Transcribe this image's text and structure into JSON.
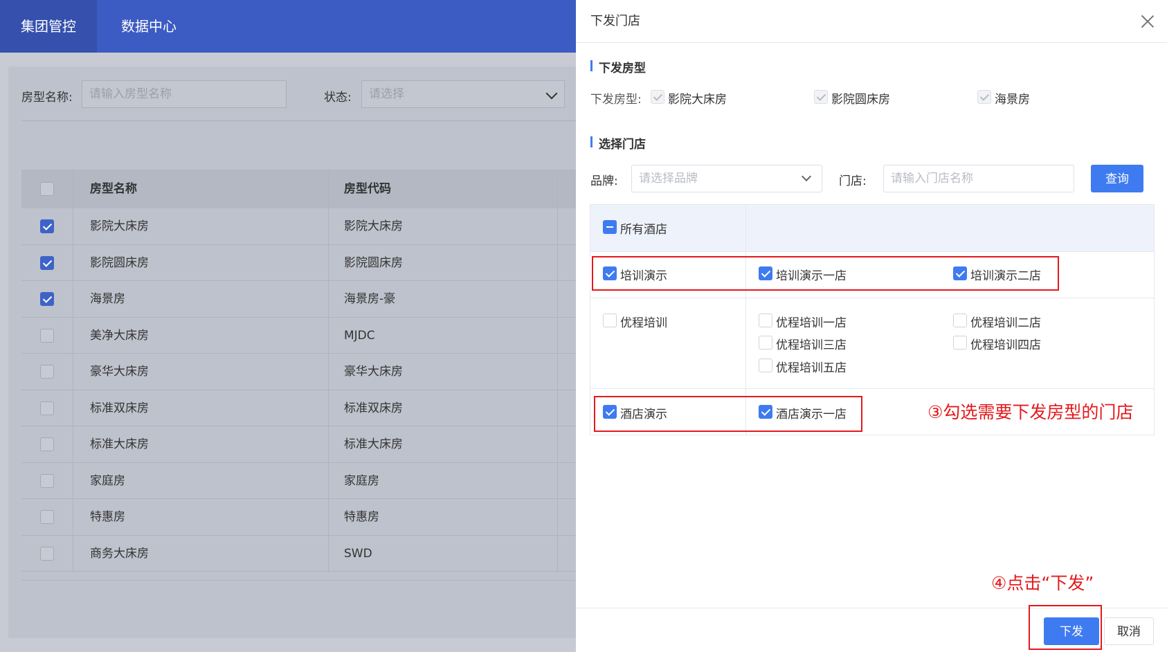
{
  "nav": {
    "tabs": [
      {
        "label": "集团管控",
        "active": true
      },
      {
        "label": "数据中心",
        "active": false
      }
    ]
  },
  "filter": {
    "room_name_label": "房型名称:",
    "room_name_placeholder": "请输入房型名称",
    "status_label": "状态:",
    "status_placeholder": "请选择"
  },
  "table": {
    "headers": [
      "房型名称",
      "房型代码"
    ],
    "rows": [
      {
        "name": "影院大床房",
        "code": "影院大床房",
        "checked": true
      },
      {
        "name": "影院圆床房",
        "code": "影院圆床房",
        "checked": true
      },
      {
        "name": "海景房",
        "code": "海景房-豪",
        "checked": true
      },
      {
        "name": "美净大床房",
        "code": "MJDC",
        "checked": false
      },
      {
        "name": "豪华大床房",
        "code": "豪华大床房",
        "checked": false
      },
      {
        "name": "标准双床房",
        "code": "标准双床房",
        "checked": false
      },
      {
        "name": "标准大床房",
        "code": "标准大床房",
        "checked": false
      },
      {
        "name": "家庭房",
        "code": "家庭房",
        "checked": false
      },
      {
        "name": "特惠房",
        "code": "特惠房",
        "checked": false
      },
      {
        "name": "商务大床房",
        "code": "SWD",
        "checked": false
      }
    ]
  },
  "drawer": {
    "title": "下发门店",
    "section_room_types": "下发房型",
    "room_types_label": "下发房型:",
    "room_types": [
      "影院大床房",
      "影院圆床房",
      "海景房"
    ],
    "section_stores": "选择门店",
    "brand_label": "品牌:",
    "brand_placeholder": "请选择品牌",
    "store_label": "门店:",
    "store_placeholder": "请输入门店名称",
    "query_button": "查询",
    "all_hotels": "所有酒店",
    "groups": [
      {
        "brand": "培训演示",
        "checked": true,
        "stores": [
          {
            "name": "培训演示一店",
            "checked": true
          },
          {
            "name": "培训演示二店",
            "checked": true
          }
        ]
      },
      {
        "brand": "优程培训",
        "checked": false,
        "stores": [
          {
            "name": "优程培训一店",
            "checked": false
          },
          {
            "name": "优程培训二店",
            "checked": false
          },
          {
            "name": "优程培训三店",
            "checked": false
          },
          {
            "name": "优程培训四店",
            "checked": false
          },
          {
            "name": "优程培训五店",
            "checked": false
          }
        ]
      },
      {
        "brand": "酒店演示",
        "checked": true,
        "stores": [
          {
            "name": "酒店演示一店",
            "checked": true
          }
        ]
      }
    ],
    "annotation_step3": "③勾选需要下发房型的门店",
    "annotation_step4": "④点击“下发”",
    "submit_button": "下发",
    "cancel_button": "取消"
  },
  "colors": {
    "primary": "#3f7bf0",
    "nav_bg": "#3c5bc3",
    "annotation_red": "#e4181b"
  }
}
